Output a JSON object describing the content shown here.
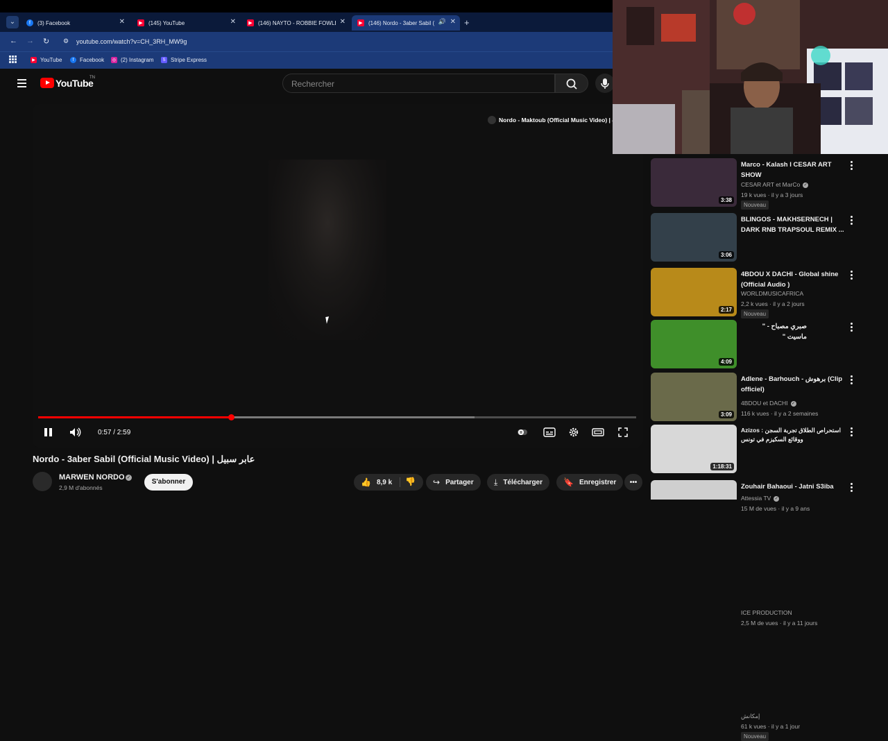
{
  "browser": {
    "tabs": [
      {
        "label": "(3) Facebook",
        "icon": "facebook-icon"
      },
      {
        "label": "(145) YouTube",
        "icon": "youtube-icon"
      },
      {
        "label": "(146) NAYTO - ROBBIE FOWLER",
        "icon": "youtube-icon"
      },
      {
        "label": "(146) Nordo - 3aber Sabil (",
        "icon": "youtube-icon"
      }
    ],
    "url": "youtube.com/watch?v=CH_3RH_MW9g",
    "bookmarks": [
      {
        "label": "YouTube"
      },
      {
        "label": "Facebook"
      },
      {
        "label": "(2) Instagram"
      },
      {
        "label": "Stripe Express"
      }
    ]
  },
  "header": {
    "logo_text": "YouTube",
    "country": "TN",
    "search_placeholder": "Rechercher"
  },
  "player": {
    "overlay_title": "Nordo - Maktoub (Official Music Video) | ب",
    "time": "0:57 / 2:59",
    "progress_fraction": 0.323,
    "buffer_fraction": 0.73
  },
  "video": {
    "title": "Nordo - 3aber Sabil (Official Music Video) | عابر سبيل",
    "channel": "MARWEN NORDO",
    "subscribers": "2,9 M d'abonnés",
    "subscribe_label": "S'abonner",
    "likes": "8,9 k",
    "share_label": "Partager",
    "download_label": "Télécharger",
    "save_label": "Enregistrer"
  },
  "recommendations": [
    {
      "title": "Marco - Kalash l CESAR ART SHOW",
      "channel": "CESAR ART et MarCo",
      "verified": true,
      "meta": "19 k vues · il y a 3 jours",
      "badge": "Nouveau",
      "duration": "3:38",
      "thumb": "#3a2a3a"
    },
    {
      "title": "BLINGOS - MAKHSERNECH | DARK RNB TRAPSOUL REMIX ...",
      "channel": "WORLDMUSICAFRICA",
      "verified": false,
      "meta": "2,2 k vues · il y a 2 jours",
      "badge": "Nouveau",
      "duration": "3:06",
      "thumb": "#33404a"
    },
    {
      "title": "4BDOU X DACHI - Global shine (Official Audio )",
      "channel": "4BDOU et DACHI",
      "verified": true,
      "meta": "116 k vues · il y a 2 semaines",
      "badge": "",
      "duration": "2:17",
      "thumb": "#b88a1a"
    },
    {
      "title": "صبري مصباح - \" ماسيت \"",
      "channel": "Attessia TV",
      "verified": true,
      "meta": "15 M de vues · il y a 9 ans",
      "badge": "",
      "duration": "4:09",
      "thumb": "#3f8f2a"
    },
    {
      "title": "Adlene - Barhouch - برهوش (Clip officiel)",
      "channel": "ICE PRODUCTION",
      "verified": false,
      "meta": "2,5 M de vues · il y a 11 jours",
      "badge": "",
      "duration": "3:09",
      "thumb": "#6a6a4a"
    },
    {
      "title": "Azizos : استحراص الطلاق تجربة السجن ووقائع السكيزم في تونس",
      "channel": "إمكانش",
      "verified": false,
      "meta": "61 k vues · il y a 1 jour",
      "badge": "Nouveau",
      "duration": "1:18:31",
      "thumb": "#d8d8d8"
    },
    {
      "title": "Zouhair Bahaoui - Jatni S3iba",
      "channel": "",
      "verified": false,
      "meta": "",
      "badge": "",
      "duration": "",
      "thumb": "#cfcfcf"
    }
  ],
  "colors": {
    "accent": "#ff0000",
    "background": "#0f0f0f",
    "browser_frame": "#1c3a78"
  }
}
